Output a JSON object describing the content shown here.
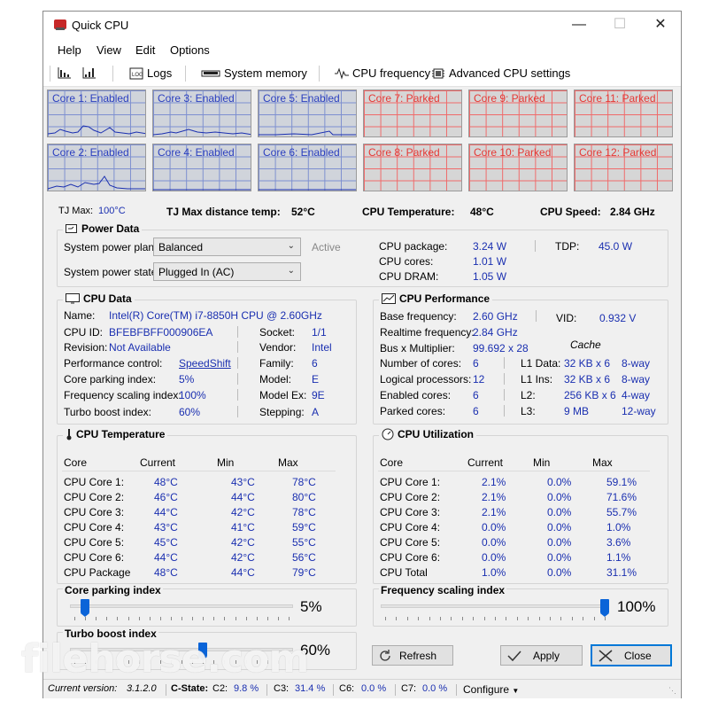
{
  "window": {
    "title": "Quick CPU",
    "min": "—",
    "max": "☐",
    "close": "✕"
  },
  "menu": [
    "Help",
    "View",
    "Edit",
    "Options"
  ],
  "toolbar": {
    "logs": "Logs",
    "system_memory": "System memory",
    "cpu_frequency": "CPU frequency",
    "advanced": "Advanced CPU settings"
  },
  "cores_top": [
    {
      "label": "Core 1: Enabled",
      "state": "enabled"
    },
    {
      "label": "Core 3: Enabled",
      "state": "enabled"
    },
    {
      "label": "Core 5: Enabled",
      "state": "enabled"
    },
    {
      "label": "Core 7: Parked",
      "state": "parked"
    },
    {
      "label": "Core 9: Parked",
      "state": "parked"
    },
    {
      "label": "Core 11: Parked",
      "state": "parked"
    }
  ],
  "cores_bottom": [
    {
      "label": "Core 2: Enabled",
      "state": "enabled"
    },
    {
      "label": "Core 4: Enabled",
      "state": "enabled"
    },
    {
      "label": "Core 6: Enabled",
      "state": "enabled"
    },
    {
      "label": "Core 8: Parked",
      "state": "parked"
    },
    {
      "label": "Core 10: Parked",
      "state": "parked"
    },
    {
      "label": "Core 12: Parked",
      "state": "parked"
    }
  ],
  "info": {
    "tjmax_label": "TJ Max:",
    "tjmax_value": "100°C",
    "tjdist_label": "TJ Max distance temp:",
    "tjdist_value": "52°C",
    "cputemp_label": "CPU Temperature:",
    "cputemp_value": "48°C",
    "cpuspeed_label": "CPU Speed:",
    "cpuspeed_value": "2.84 GHz"
  },
  "power": {
    "title": "Power Data",
    "plan_label": "System power plan:",
    "plan_value": "Balanced",
    "active": "Active",
    "state_label": "System power state:",
    "state_value": "Plugged In (AC)",
    "pkg_label": "CPU package:",
    "pkg_value": "3.24 W",
    "cores_label": "CPU cores:",
    "cores_value": "1.01 W",
    "dram_label": "CPU DRAM:",
    "dram_value": "1.05 W",
    "tdp_label": "TDP:",
    "tdp_value": "45.0 W"
  },
  "cpu_data": {
    "title": "CPU Data",
    "name_label": "Name:",
    "name_value": "Intel(R) Core(TM) i7-8850H CPU @ 2.60GHz",
    "id_label": "CPU ID:",
    "id_value": "BFEBFBFF000906EA",
    "rev_label": "Revision:",
    "rev_value": "Not Available",
    "perf_label": "Performance control:",
    "perf_value": "SpeedShift",
    "park_label": "Core parking index:",
    "park_value": "5%",
    "freq_label": "Frequency scaling index:",
    "freq_value": "100%",
    "turbo_label": "Turbo boost index:",
    "turbo_value": "60%",
    "socket_label": "Socket:",
    "socket_value": "1/1",
    "vendor_label": "Vendor:",
    "vendor_value": "Intel",
    "family_label": "Family:",
    "family_value": "6",
    "model_label": "Model:",
    "model_value": "E",
    "modelex_label": "Model Ex:",
    "modelex_value": "9E",
    "stepping_label": "Stepping:",
    "stepping_value": "A"
  },
  "cpu_perf": {
    "title": "CPU Performance",
    "base_label": "Base frequency:",
    "base_value": "2.60 GHz",
    "real_label": "Realtime frequency:",
    "real_value": "2.84 GHz",
    "bus_label": "Bus x Multiplier:",
    "bus_value": "99.692 x 28",
    "vid_label": "VID:",
    "vid_value": "0.932 V",
    "cache_label": "Cache",
    "num_label": "Number of cores:",
    "num_value": "6",
    "logical_label": "Logical processors:",
    "logical_value": "12",
    "enabled_label": "Enabled cores:",
    "enabled_value": "6",
    "parked_label": "Parked cores:",
    "parked_value": "6",
    "l1d_label": "L1 Data:",
    "l1d_value": "32 KB x 6",
    "l1d_way": "8-way",
    "l1i_label": "L1 Ins:",
    "l1i_value": "32 KB x 6",
    "l1i_way": "8-way",
    "l2_label": "L2:",
    "l2_value": "256 KB x 6",
    "l2_way": "4-way",
    "l3_label": "L3:",
    "l3_value": "9 MB",
    "l3_way": "12-way"
  },
  "cpu_temp": {
    "title": "CPU Temperature",
    "headers": [
      "Core",
      "Current",
      "Min",
      "Max"
    ],
    "rows": [
      [
        "CPU Core 1:",
        "48°C",
        "43°C",
        "78°C"
      ],
      [
        "CPU Core 2:",
        "46°C",
        "44°C",
        "80°C"
      ],
      [
        "CPU Core 3:",
        "44°C",
        "42°C",
        "78°C"
      ],
      [
        "CPU Core 4:",
        "43°C",
        "41°C",
        "59°C"
      ],
      [
        "CPU Core 5:",
        "45°C",
        "42°C",
        "55°C"
      ],
      [
        "CPU Core 6:",
        "44°C",
        "42°C",
        "56°C"
      ],
      [
        "CPU Package",
        "48°C",
        "44°C",
        "79°C"
      ]
    ]
  },
  "cpu_util": {
    "title": "CPU Utilization",
    "headers": [
      "Core",
      "Current",
      "Min",
      "Max"
    ],
    "rows": [
      [
        "CPU Core 1:",
        "2.1%",
        "0.0%",
        "59.1%"
      ],
      [
        "CPU Core 2:",
        "2.1%",
        "0.0%",
        "71.6%"
      ],
      [
        "CPU Core 3:",
        "2.1%",
        "0.0%",
        "55.7%"
      ],
      [
        "CPU Core 4:",
        "0.0%",
        "0.0%",
        "1.0%"
      ],
      [
        "CPU Core 5:",
        "0.0%",
        "0.0%",
        "3.6%"
      ],
      [
        "CPU Core 6:",
        "0.0%",
        "0.0%",
        "1.1%"
      ],
      [
        "CPU Total",
        "1.0%",
        "0.0%",
        "31.1%"
      ]
    ]
  },
  "sliders": {
    "parking_title": "Core parking index",
    "parking_value": "5%",
    "parking_level": 0.05,
    "freq_title": "Frequency scaling index",
    "freq_value": "100%",
    "freq_level": 1.0,
    "turbo_title": "Turbo boost index",
    "turbo_value": "60%",
    "turbo_level": 0.6
  },
  "buttons": {
    "refresh": "Refresh",
    "apply": "Apply",
    "close": "Close"
  },
  "status": {
    "version_label": "Current version:",
    "version_value": "3.1.2.0",
    "cstate_label": "C-State:",
    "c2_label": "C2:",
    "c2_value": "9.8 %",
    "c3_label": "C3:",
    "c3_value": "31.4 %",
    "c6_label": "C6:",
    "c6_value": "0.0 %",
    "c7_label": "C7:",
    "c7_value": "0.0 %",
    "configure": "Configure"
  },
  "watermark": "filehorse.com"
}
